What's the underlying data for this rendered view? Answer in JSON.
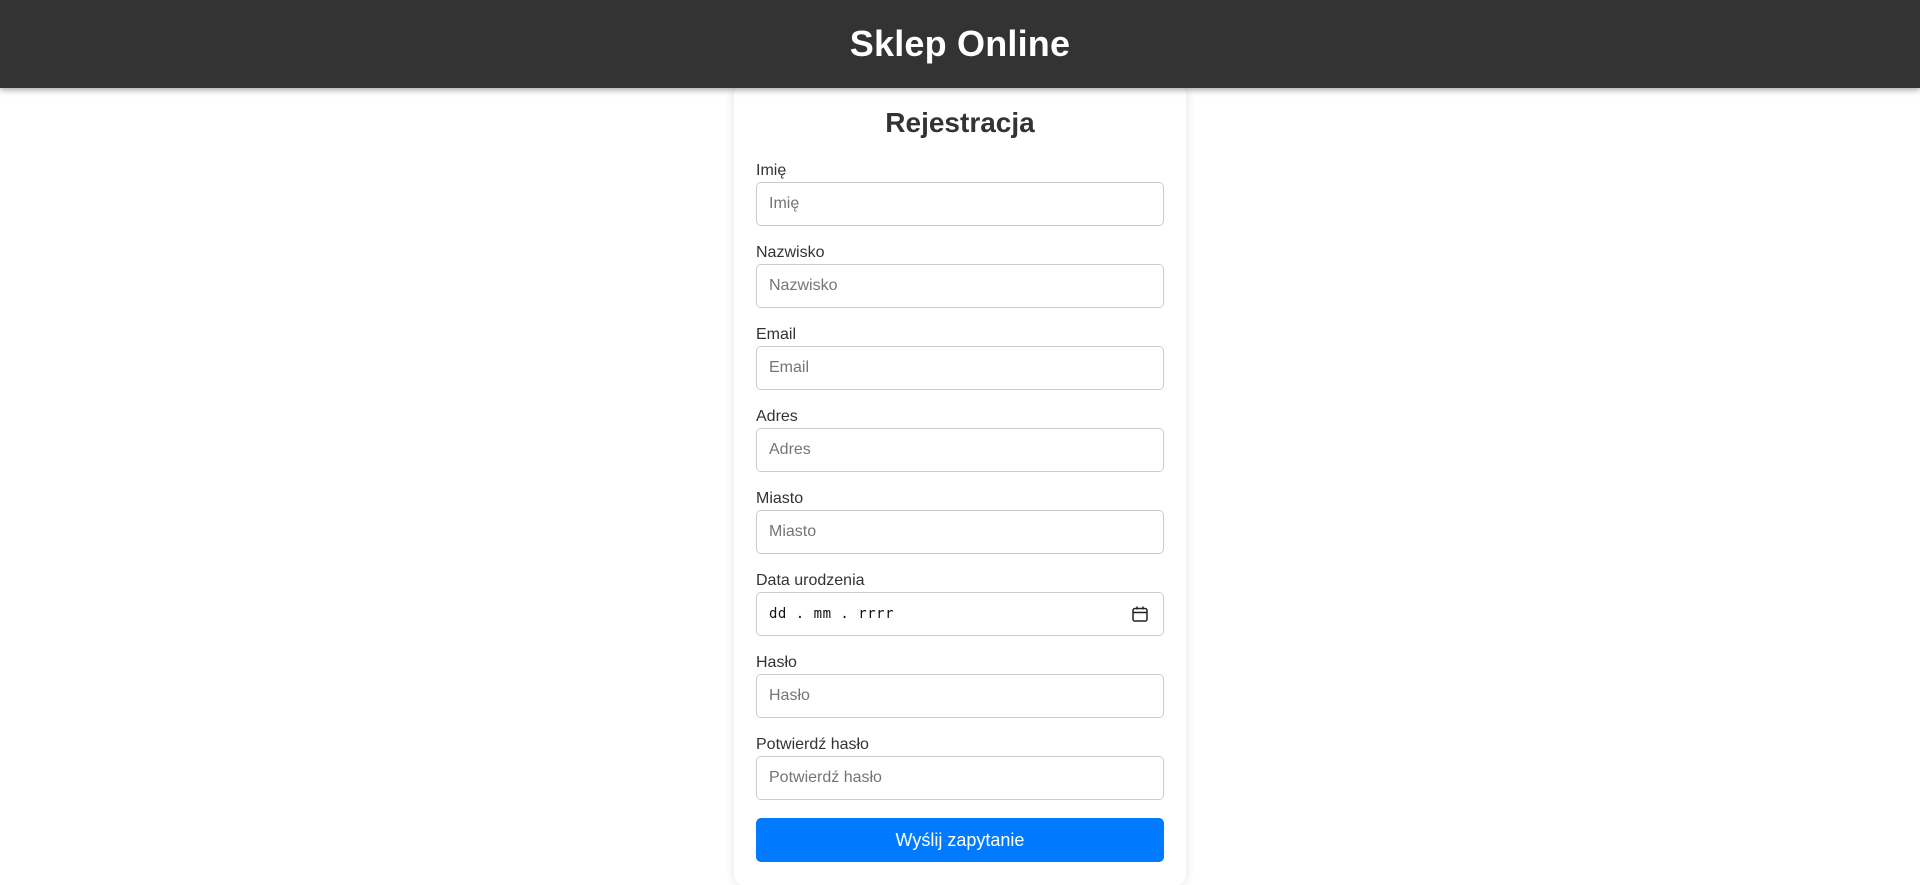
{
  "header": {
    "title": "Sklep Online"
  },
  "form": {
    "title": "Rejestracja",
    "fields": [
      {
        "label": "Imię",
        "placeholder": "Imię",
        "type": "text"
      },
      {
        "label": "Nazwisko",
        "placeholder": "Nazwisko",
        "type": "text"
      },
      {
        "label": "Email",
        "placeholder": "Email",
        "type": "email"
      },
      {
        "label": "Adres",
        "placeholder": "Adres",
        "type": "text"
      },
      {
        "label": "Miasto",
        "placeholder": "Miasto",
        "type": "text"
      },
      {
        "label": "Data urodzenia",
        "placeholder": "dd . mm . rrrr",
        "type": "date",
        "icon": "calendar-icon"
      },
      {
        "label": "Hasło",
        "placeholder": "Hasło",
        "type": "password"
      },
      {
        "label": "Potwierdź hasło",
        "placeholder": "Potwierdź hasło",
        "type": "password"
      }
    ],
    "submit_label": "Wyślij zapytanie"
  },
  "colors": {
    "header_bg": "#333333",
    "button_bg": "#007bff",
    "border": "#cccccc"
  }
}
